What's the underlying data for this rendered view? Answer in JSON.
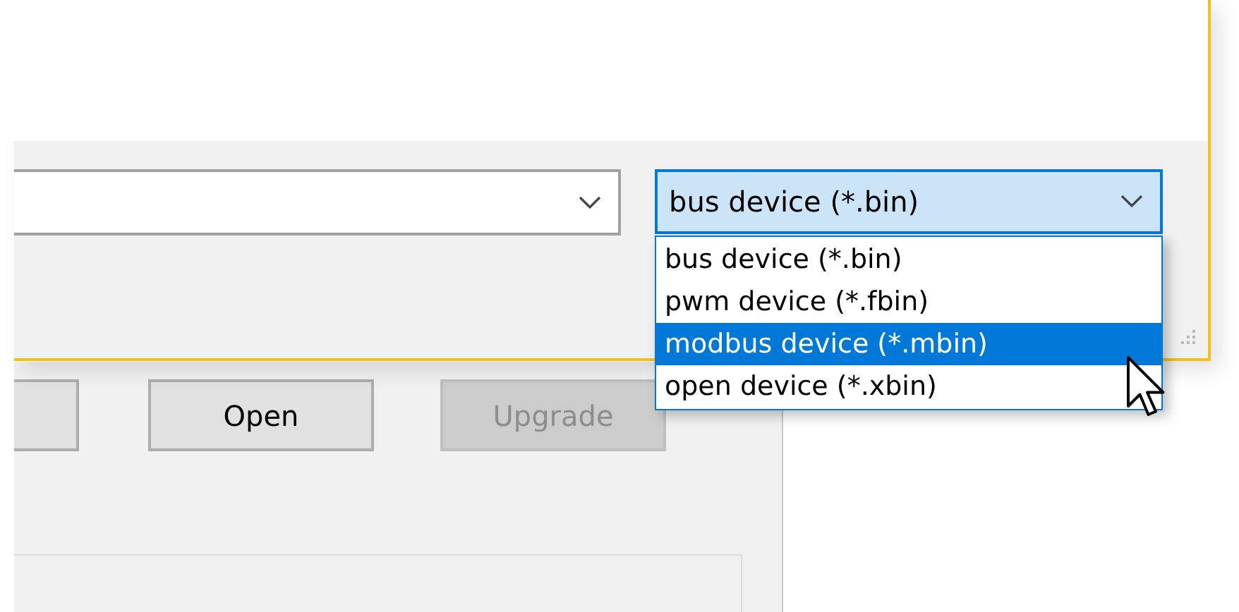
{
  "filter_combo": {
    "value": "bus device (*.bin)",
    "expanded": true
  },
  "filter_options": [
    {
      "label": "bus device (*.bin)",
      "selected": false
    },
    {
      "label": "pwm device (*.fbin)",
      "selected": false
    },
    {
      "label": "modbus device (*.mbin)",
      "selected": true
    },
    {
      "label": "open device (*.xbin)",
      "selected": false
    }
  ],
  "buttons": [
    {
      "label": "Open",
      "disabled": false
    },
    {
      "label": "Upgrade",
      "disabled": true
    }
  ]
}
